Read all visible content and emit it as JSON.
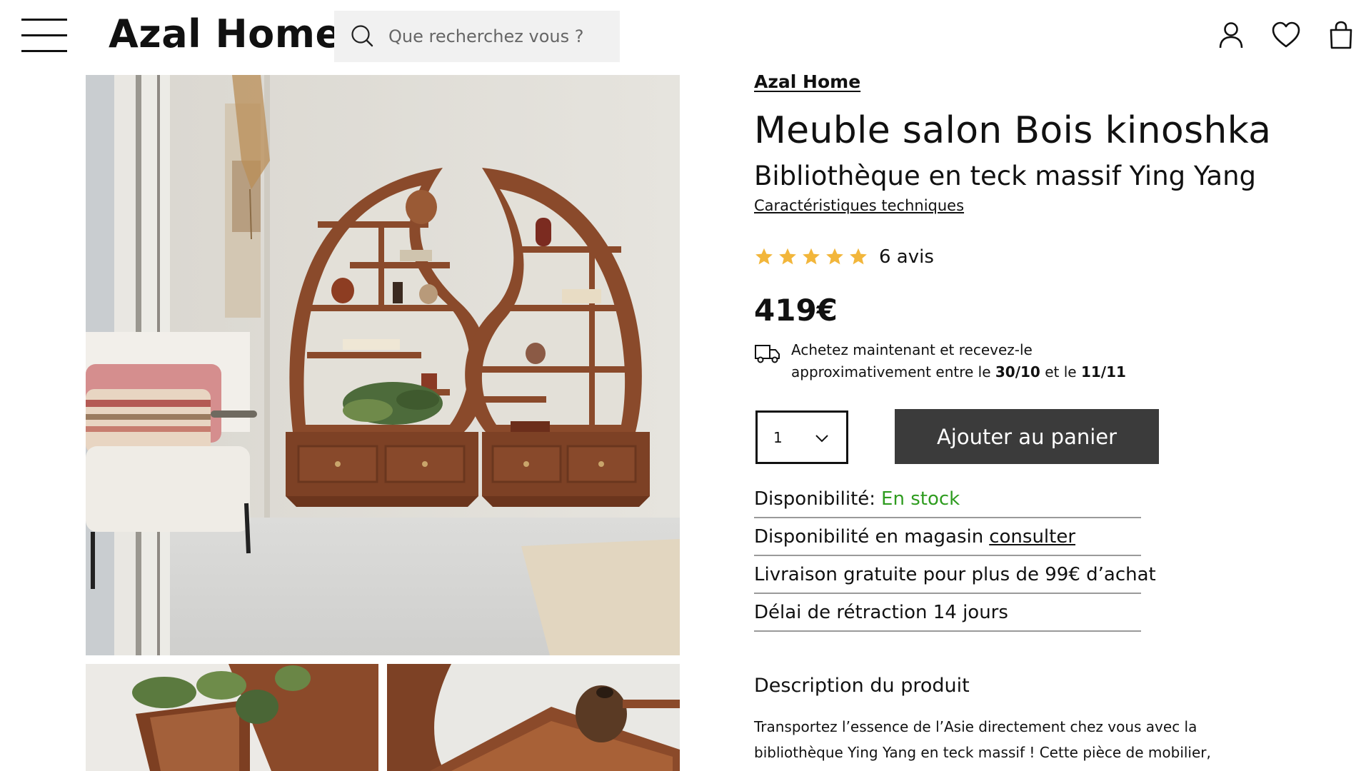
{
  "header": {
    "logo": "Azal Home",
    "search_placeholder": "Que recherchez vous ?",
    "icons": [
      "menu-icon",
      "search-icon",
      "account-icon",
      "wishlist-heart-icon",
      "shopping-bag-icon"
    ]
  },
  "gallery": {
    "main_image": "yin-yang-teak-bookshelf-living-room-photo",
    "thumbnails": [
      "bookshelf-detail-plant-photo",
      "bookshelf-detail-vase-photo"
    ]
  },
  "product": {
    "brand": "Azal Home",
    "title": "Meuble salon Bois kinoshka",
    "subtitle": "Bibliothèque en teck massif Ying Yang",
    "tech_link": "Caractéristiques techniques",
    "rating": 5,
    "rating_max": 5,
    "reviews": "6 avis",
    "price": "419€",
    "delivery": {
      "line1": "Achetez maintenant et recevez-le",
      "line2_prefix": "approximativement entre le ",
      "date_from": "30/10",
      "line2_mid": " et le ",
      "date_to": "11/11"
    },
    "quantity": "1",
    "add_to_cart": "Ajouter au panier",
    "info": {
      "availability_label": "Disponibilité:",
      "availability_value": "En stock",
      "store_label": "Disponibilité en magasin",
      "store_link": "consulter",
      "shipping": "Livraison gratuite pour plus de 99€ d’achat",
      "retraction": "Délai de rétraction 14 jours"
    },
    "description_title": "Description du produit",
    "description_text": "Transportez l’essence de l’Asie directement chez vous avec la bibliothèque Ying Yang en teck massif ! Cette pièce de mobilier, clairement influencée par le design oriental, vous invite à un voyage"
  },
  "colors": {
    "button_bg": "#3b3b3b",
    "in_stock": "#2e9c1f",
    "star": "#f2b63b",
    "search_bg": "#f1f1f1"
  }
}
